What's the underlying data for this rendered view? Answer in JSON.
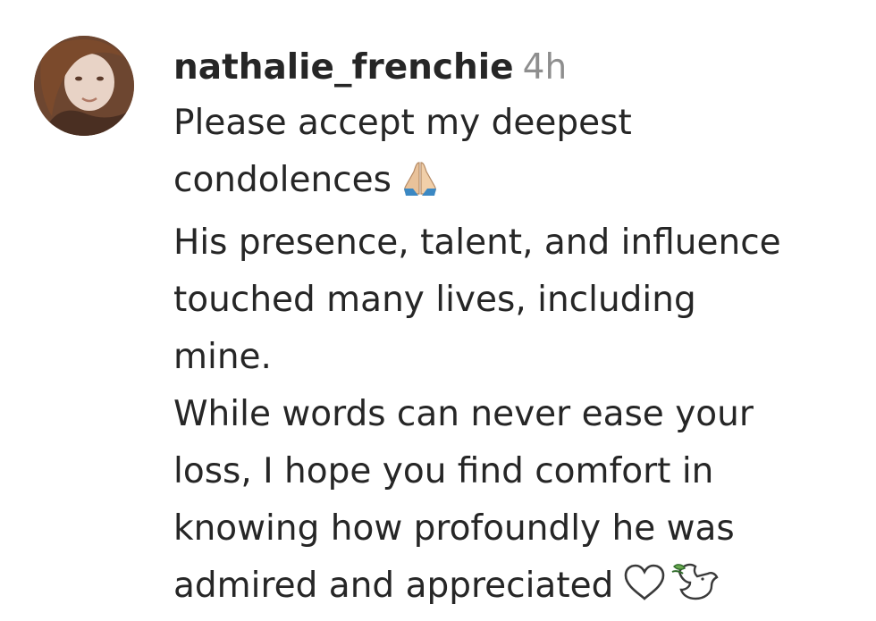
{
  "comment": {
    "username": "nathalie_frenchie",
    "timestamp": "4h",
    "avatar_icon": "user-avatar-photo",
    "lines": [
      "Please accept my deepest",
      "condolences",
      "His presence, talent, and influence",
      "touched many lives, including",
      "mine.",
      "While words can never ease your",
      "loss, I hope you find comfort in",
      "knowing how profoundly he was",
      "admired and appreciated"
    ],
    "emojis": {
      "praying_hands": "folded-hands-icon",
      "white_heart": "white-heart-icon",
      "dove": "dove-icon"
    }
  },
  "colors": {
    "text": "#262626",
    "muted": "#8e8e8e",
    "background": "#ffffff"
  }
}
